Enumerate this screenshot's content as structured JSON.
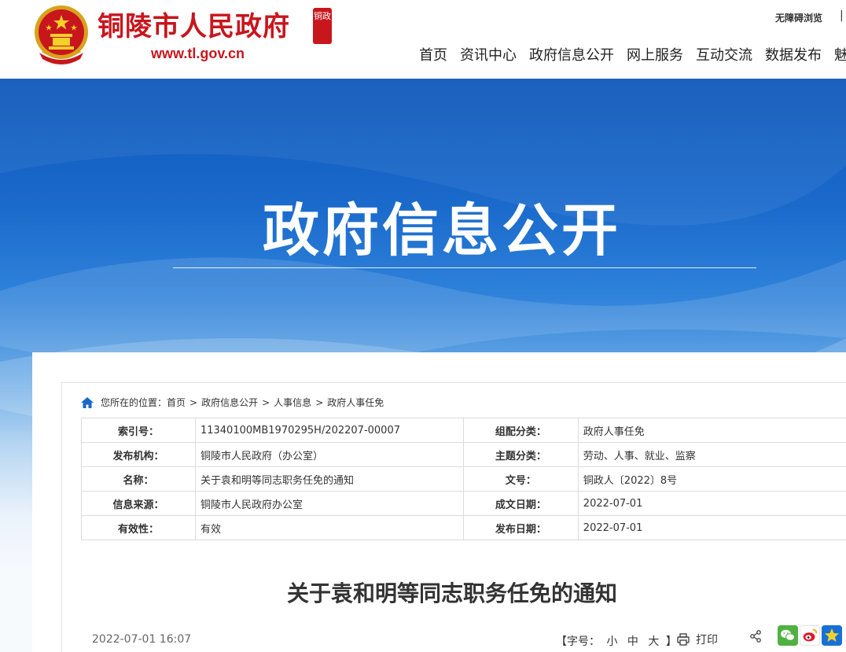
{
  "header": {
    "site_title": "铜陵市人民政府",
    "seal_text": "铜政",
    "site_url": "www.tl.gov.cn",
    "accessibility_link": "无障碍浏览",
    "top_separator": "|",
    "nav": [
      "首页",
      "资讯中心",
      "政府信息公开",
      "网上服务",
      "互动交流",
      "数据发布",
      "魅"
    ]
  },
  "banner": {
    "title": "政府信息公开"
  },
  "breadcrumb": {
    "prefix": "您所在的位置：",
    "items": [
      "首页",
      "政府信息公开",
      "人事信息",
      "政府人事任免"
    ],
    "separator": ">"
  },
  "meta": {
    "rows": [
      {
        "label1": "索引号：",
        "value1": "11340100MB1970295H/202207-00007",
        "label2": "组配分类：",
        "value2": "政府人事任免"
      },
      {
        "label1": "发布机构：",
        "value1": "铜陵市人民政府（办公室）",
        "label2": "主题分类：",
        "value2": "劳动、人事、就业、监察"
      },
      {
        "label1": "名称：",
        "value1": "关于袁和明等同志职务任免的通知",
        "label2": "文号：",
        "value2": "铜政人〔2022〕8号"
      },
      {
        "label1": "信息来源：",
        "value1": "铜陵市人民政府办公室",
        "label2": "成文日期：",
        "value2": "2022-07-01"
      },
      {
        "label1": "有效性：",
        "value1": "有效",
        "label2": "发布日期：",
        "value2": "2022-07-01"
      }
    ]
  },
  "article": {
    "title": "关于袁和明等同志职务任免的通知",
    "date": "2022-07-01 16:07",
    "font_size_prefix": "【字号：",
    "font_small": "小",
    "font_medium": "中",
    "font_large": "大",
    "font_size_suffix": "】",
    "print_label": "打印"
  },
  "colors": {
    "brand_red": "#c8161d",
    "banner_blue": "#0d57b8",
    "wechat_green": "#50b041",
    "favorite_blue": "#1670d6"
  },
  "icons": {
    "emblem": "national-emblem-icon",
    "home": "home-icon",
    "print": "print-icon",
    "share": "share-icon",
    "wechat": "wechat-icon",
    "weibo": "weibo-icon",
    "favorite": "star-favorite-icon"
  }
}
